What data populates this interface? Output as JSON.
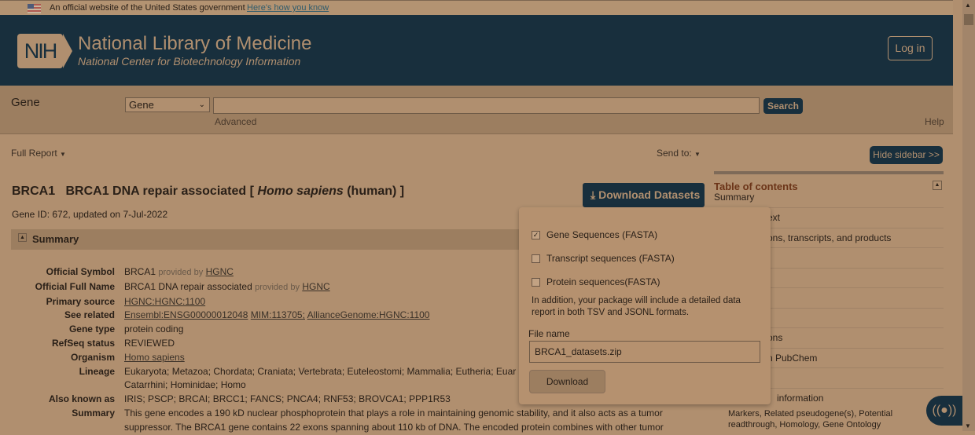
{
  "gov_banner": {
    "text": "An official website of the United States government",
    "link": "Here's how you know"
  },
  "header": {
    "logo": "NIH",
    "title": "National Library of Medicine",
    "subtitle": "National Center for Biotechnology Information",
    "login": "Log in"
  },
  "search": {
    "db_label": "Gene",
    "select_value": "Gene",
    "query": "",
    "button": "Search",
    "advanced": "Advanced",
    "help": "Help"
  },
  "toolbar": {
    "full_report": "Full Report",
    "send_to": "Send to:",
    "hide_sidebar": "Hide sidebar >>"
  },
  "gene": {
    "symbol": "BRCA1",
    "title_pre": "BRCA1 DNA repair associated [",
    "species": "Homo sapiens",
    "title_post": "(human) ]",
    "gene_id": "Gene ID: 672, updated on 7-Jul-2022",
    "download": "Download Datasets"
  },
  "summary": {
    "heading": "Summary",
    "rows": [
      {
        "k": "Official Symbol",
        "v": "BRCA1",
        "pb": "provided by",
        "link": "HGNC"
      },
      {
        "k": "Official Full Name",
        "v": "BRCA1 DNA repair associated",
        "pb": "provided by",
        "link": "HGNC"
      },
      {
        "k": "Primary source",
        "link": "HGNC:HGNC:1100"
      },
      {
        "k": "See related",
        "links": [
          "Ensembl:ENSG00000012048",
          "MIM:113705;",
          "AllianceGenome:HGNC:1100"
        ]
      },
      {
        "k": "Gene type",
        "v": "protein coding"
      },
      {
        "k": "RefSeq status",
        "v": "REVIEWED"
      },
      {
        "k": "Organism",
        "link": "Homo sapiens"
      },
      {
        "k": "Lineage",
        "v": "Eukaryota; Metazoa; Chordata; Craniata; Vertebrata; Euteleostomi; Mammalia; Eutheria; Euar",
        "v2": "Catarrhini; Hominidae; Homo"
      },
      {
        "k": "Also known as",
        "v": "IRIS; PSCP; BRCAI; BRCC1; FANCS; PNCA4; RNF53; BROVCA1; PPP1R53"
      },
      {
        "k": "Summary",
        "v": "This gene encodes a 190 kD nuclear phosphoprotein that plays a role in maintaining genomic stability, and it also acts as a tumor",
        "v2": "suppressor. The BRCA1 gene contains 22 exons spanning about 110 kb of DNA. The encoded protein combines with other tumor"
      }
    ]
  },
  "toc": {
    "title": "Table of contents",
    "items": [
      "Summary",
      "ext",
      "ons, transcripts, and products",
      "",
      "",
      "",
      "",
      "ons",
      "n PubChem",
      "",
      "information"
    ],
    "sub": "Markers,  Related pseudogene(s),  Potential readthrough,  Homology,  Gene Ontology"
  },
  "popup": {
    "options": [
      {
        "label": "Gene Sequences (FASTA)",
        "checked": true
      },
      {
        "label": "Transcript sequences (FASTA)",
        "checked": false
      },
      {
        "label": "Protein sequences(FASTA)",
        "checked": false
      }
    ],
    "note": "In addition, your package will include a detailed data report in both TSV and JSONL formats.",
    "file_label": "File name",
    "file_value": "BRCA1_datasets.zip",
    "download": "Download"
  }
}
